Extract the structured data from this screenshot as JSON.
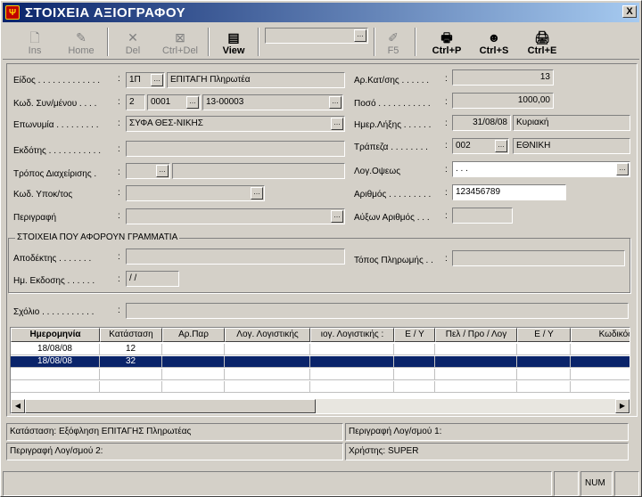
{
  "window": {
    "title": "ΣΤΟΙΧΕΙΑ ΑΞΙΟΓΡΑΦΟΥ",
    "close": "X"
  },
  "toolbar": {
    "ins": "Ins",
    "home": "Home",
    "del": "Del",
    "ctrl_del": "Ctrl+Del",
    "view": "View",
    "f5": "F5",
    "ctrl_p": "Ctrl+P",
    "ctrl_s": "Ctrl+S",
    "ctrl_e": "Ctrl+E"
  },
  "form": {
    "eidos_label": "Είδος . . . . . . . . . . . . .",
    "eidos_code": "1Π",
    "eidos_desc": "ΕΠΙΤΑΓΗ Πληρωτέα",
    "kod_syn_label": "Κωδ. Συν/μένου . . . .",
    "kod_syn_type": "2",
    "kod_syn_code": "0001",
    "kod_syn_acc": "13-00003",
    "eponymia_label": "Επωνυμία . . . . . . . . .",
    "eponymia_value": "ΣΥΦΑ ΘΕΣ-ΝΙΚΗΣ",
    "ekdotis_label": "Εκδότης . . . . . . . . . . .",
    "ekdotis_value": "",
    "tropos_label": "Τρόπος Διαχείρισης .",
    "kod_ypok_label": "Κωδ. Υποκ/τος",
    "perigrafi_label": "Περιγραφή",
    "ar_katosis_label": "Αρ.Κατ/σης . . . . . .",
    "ar_katosis_value": "13",
    "poso_label": "Ποσό . . . . . . . . . . .",
    "poso_value": "1000,00",
    "imer_lixis_label": "Ημερ.Λήξης . . . . . .",
    "imer_lixis_value": "31/08/08",
    "imer_lixis_day": "Κυριακή",
    "trapeza_label": "Τράπεζα . . . . . . . .",
    "trapeza_code": "002",
    "trapeza_name": "ΕΘΝΙΚΗ",
    "log_opseos_label": "Λογ.Οψεως",
    "log_opseos_value": ". . .",
    "arithmos_label": "Αριθμός . . . . . . . . .",
    "arithmos_value": "123456789",
    "ayxon_label": "Αύξων Αριθμός . . .",
    "ayxon_value": ""
  },
  "grammatia": {
    "title": "ΣΤΟΙΧΕΙΑ ΠΟΥ ΑΦΟΡΟΥΝ ΓΡΑΜΜΑΤΙΑ",
    "apodektis_label": "Αποδέκτης . . . . . . .",
    "topos_label": "Τόπος Πληρωμής . .",
    "im_ekdosis_label": "Ημ. Εκδοσης . . . . . .",
    "im_ekdosis_value": "/ /"
  },
  "scholio": {
    "label": "Σχόλιο . . . . . . . . . . .",
    "value": ""
  },
  "grid": {
    "columns": [
      "Ημερομηνία",
      "Κατάσταση",
      "Αρ.Παρ",
      "Λογ. Λογιστικής",
      "ιογ. Λογιστικής :",
      "Ε / Υ",
      "Πελ / Προ / Λογ",
      "Ε / Υ",
      "Κωδικός"
    ],
    "rows": [
      {
        "date": "18/08/08",
        "status": "12"
      },
      {
        "date": "18/08/08",
        "status": "32"
      }
    ]
  },
  "status": {
    "katastasi": "Κατάσταση: Εξόφληση  ΕΠΙΤΑΓΗΣ  Πληρωτέας",
    "perigrafi1": "Περιγραφή Λογ/σμού 1:",
    "perigrafi2": "Περιγραφή Λογ/σμού 2:",
    "xristis": "Χρήστης: SUPER",
    "num": "NUM"
  }
}
